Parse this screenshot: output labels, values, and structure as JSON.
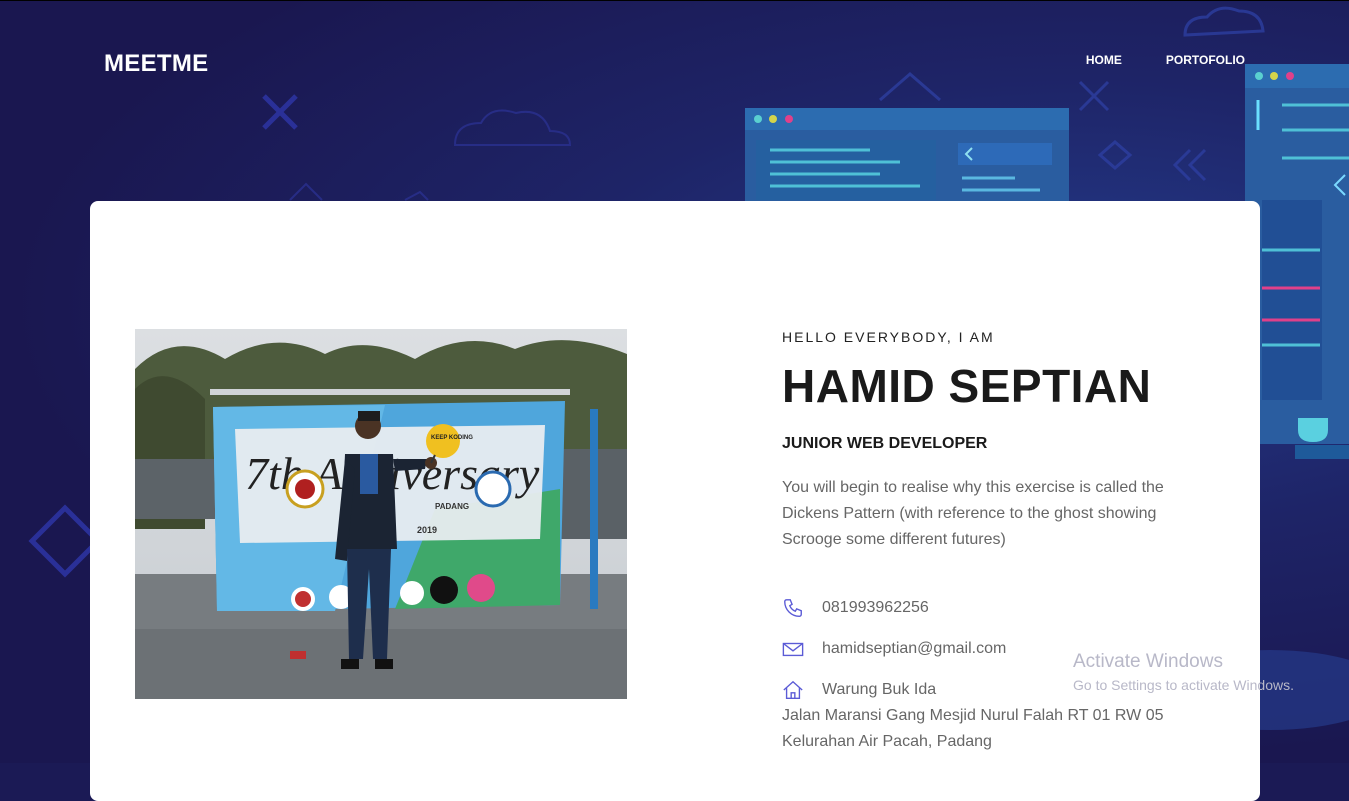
{
  "header": {
    "logo": "MEETME",
    "nav": [
      {
        "label": "HOME"
      },
      {
        "label": "PORTOFOLIO"
      }
    ]
  },
  "profile": {
    "greeting": "HELLO EVERYBODY, I AM",
    "name": "HAMID SEPTIAN",
    "role": "JUNIOR WEB DEVELOPER",
    "description": "You will begin to realise why this exercise is called the Dickens Pattern (with reference to the ghost showing Scrooge some different futures)",
    "photo_alt": "Profile photo"
  },
  "contact": {
    "phone": "081993962256",
    "email": "hamidseptian@gmail.com",
    "address_line1": "Warung Buk Ida",
    "address_line2": "Jalan Maransi Gang Mesjid Nurul Falah RT 01 RW 05",
    "address_line3": "Kelurahan Air Pacah, Padang"
  },
  "photo_banner": {
    "headline": "7th Anniversary",
    "badge": "KEEP KODING",
    "sub": "PADANG",
    "year": "2019"
  },
  "watermark": {
    "line1": "Activate Windows",
    "line2": "Go to Settings to activate Windows."
  },
  "colors": {
    "background": "#1b1a55",
    "card": "#ffffff",
    "accent": "#6a5acd",
    "text_dark": "#1a1a1a",
    "text_muted": "#666666"
  }
}
